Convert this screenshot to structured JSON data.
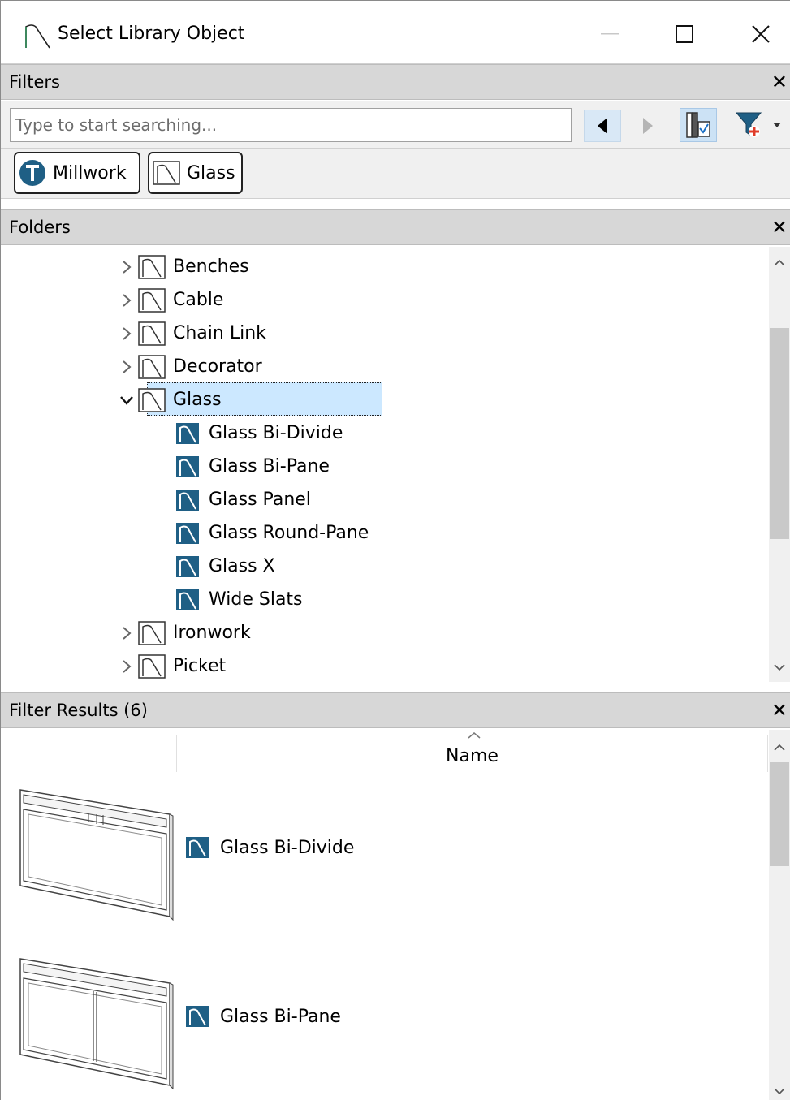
{
  "window": {
    "title": "Select Library Object"
  },
  "filters": {
    "header": "Filters",
    "search_placeholder": "Type to start searching...",
    "tags": [
      {
        "label": "Millwork",
        "icon": "millwork-t-icon"
      },
      {
        "label": "Glass",
        "icon": "railing-folder-icon"
      }
    ]
  },
  "folders": {
    "header": "Folders",
    "items": [
      {
        "label": "Benches",
        "type": "folder",
        "expanded": false
      },
      {
        "label": "Cable",
        "type": "folder",
        "expanded": false
      },
      {
        "label": "Chain Link",
        "type": "folder",
        "expanded": false
      },
      {
        "label": "Decorator",
        "type": "folder",
        "expanded": false
      },
      {
        "label": "Glass",
        "type": "folder",
        "expanded": true,
        "selected": true
      },
      {
        "label": "Glass Bi-Divide",
        "type": "item"
      },
      {
        "label": "Glass Bi-Pane",
        "type": "item"
      },
      {
        "label": "Glass Panel",
        "type": "item"
      },
      {
        "label": "Glass Round-Pane",
        "type": "item"
      },
      {
        "label": "Glass X",
        "type": "item"
      },
      {
        "label": "Wide Slats",
        "type": "item"
      },
      {
        "label": "Ironwork",
        "type": "folder",
        "expanded": false
      },
      {
        "label": "Picket",
        "type": "folder",
        "expanded": false
      }
    ]
  },
  "results": {
    "header": "Filter Results (6)",
    "column_name": "Name",
    "rows": [
      {
        "label": "Glass Bi-Divide"
      },
      {
        "label": "Glass Bi-Pane"
      }
    ]
  },
  "colors": {
    "accent_icon": "#1f5f85",
    "selection": "#cce8ff",
    "section_header": "#d7d7d7"
  }
}
